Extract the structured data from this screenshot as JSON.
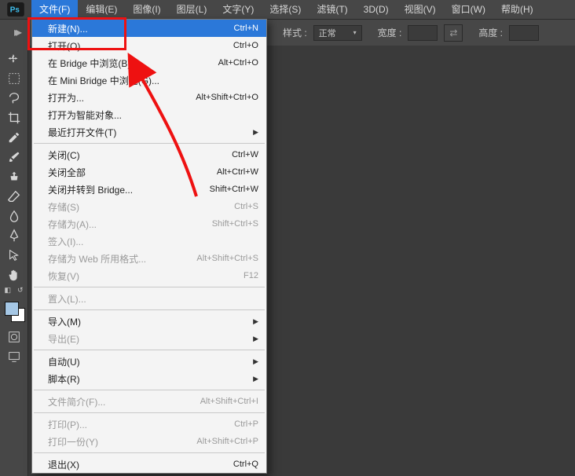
{
  "menubar": {
    "items": [
      {
        "label": "文件(F)"
      },
      {
        "label": "编辑(E)"
      },
      {
        "label": "图像(I)"
      },
      {
        "label": "图层(L)"
      },
      {
        "label": "文字(Y)"
      },
      {
        "label": "选择(S)"
      },
      {
        "label": "滤镜(T)"
      },
      {
        "label": "3D(D)"
      },
      {
        "label": "视图(V)"
      },
      {
        "label": "窗口(W)"
      },
      {
        "label": "帮助(H)"
      }
    ]
  },
  "optionsbar": {
    "style_label": "样式 :",
    "style_value": "正常",
    "width_label": "宽度 :",
    "height_label": "高度 :"
  },
  "file_menu": {
    "items": [
      {
        "label": "新建(N)...",
        "shortcut": "Ctrl+N",
        "highlight": true
      },
      {
        "label": "打开(O)...",
        "shortcut": "Ctrl+O"
      },
      {
        "label": "在 Bridge 中浏览(B)...",
        "shortcut": "Alt+Ctrl+O"
      },
      {
        "label": "在 Mini Bridge 中浏览(G)..."
      },
      {
        "label": "打开为...",
        "shortcut": "Alt+Shift+Ctrl+O"
      },
      {
        "label": "打开为智能对象..."
      },
      {
        "label": "最近打开文件(T)",
        "submenu": true
      },
      {
        "sep": true
      },
      {
        "label": "关闭(C)",
        "shortcut": "Ctrl+W"
      },
      {
        "label": "关闭全部",
        "shortcut": "Alt+Ctrl+W"
      },
      {
        "label": "关闭并转到 Bridge...",
        "shortcut": "Shift+Ctrl+W"
      },
      {
        "label": "存储(S)",
        "shortcut": "Ctrl+S",
        "disabled": true
      },
      {
        "label": "存储为(A)...",
        "shortcut": "Shift+Ctrl+S",
        "disabled": true
      },
      {
        "label": "签入(I)...",
        "disabled": true
      },
      {
        "label": "存储为 Web 所用格式...",
        "shortcut": "Alt+Shift+Ctrl+S",
        "disabled": true
      },
      {
        "label": "恢复(V)",
        "shortcut": "F12",
        "disabled": true
      },
      {
        "sep": true
      },
      {
        "label": "置入(L)...",
        "disabled": true
      },
      {
        "sep": true
      },
      {
        "label": "导入(M)",
        "submenu": true
      },
      {
        "label": "导出(E)",
        "submenu": true,
        "disabled": true
      },
      {
        "sep": true
      },
      {
        "label": "自动(U)",
        "submenu": true
      },
      {
        "label": "脚本(R)",
        "submenu": true
      },
      {
        "sep": true
      },
      {
        "label": "文件简介(F)...",
        "shortcut": "Alt+Shift+Ctrl+I",
        "disabled": true
      },
      {
        "sep": true
      },
      {
        "label": "打印(P)...",
        "shortcut": "Ctrl+P",
        "disabled": true
      },
      {
        "label": "打印一份(Y)",
        "shortcut": "Alt+Shift+Ctrl+P",
        "disabled": true
      },
      {
        "sep": true
      },
      {
        "label": "退出(X)",
        "shortcut": "Ctrl+Q"
      }
    ]
  },
  "tools": [
    "move",
    "marquee",
    "lasso",
    "crop",
    "eyedropper",
    "brush",
    "clone",
    "eraser",
    "blur",
    "pen",
    "path-select",
    "hand"
  ],
  "swatch_fg": "#a5c7e5",
  "swatch_bg": "#ffffff"
}
